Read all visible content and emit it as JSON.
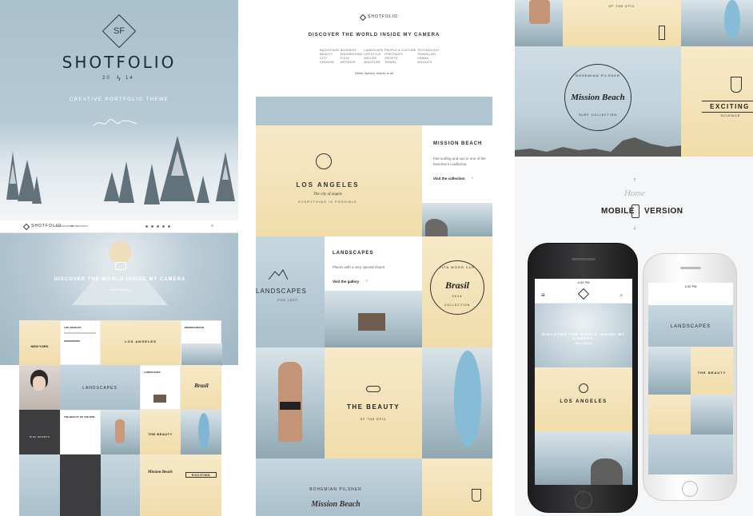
{
  "panel1": {
    "logo_mark": "SF",
    "brand": "SHOTFOLIO",
    "year_left": "20",
    "year_right": "14",
    "tagline": "CREATIVE PORTFOLIO THEME",
    "nav_brand": "SHOTFOLIO",
    "nav_items": [
      "SHOP",
      "CATEGORY",
      "BLOG",
      "CONTACT"
    ],
    "hero_title": "DISCOVER THE WORLD INSIDE MY CAMERA",
    "hero_sub": "Albert Spicery",
    "tiles": {
      "new_york": "NEW YORK",
      "los_angeles_title": "LOS ANGELES",
      "los_angeles_badge": "LOS ANGELES",
      "mission_beach": "MISSION BEACH",
      "landscapes": "LANDSCAPES",
      "landscapes_title": "LANDSCAPES",
      "brasil": "Brasil",
      "beauty_title": "THE BEAUTY OF THE EPIC",
      "beauty_badge": "THE BEAUTY",
      "risk_sports": "RISK SPORTS",
      "exciting": "EXCITING",
      "mission_small": "Mission Beach"
    }
  },
  "panel2": {
    "brand": "SHOTFOLIO",
    "title": "DISCOVER THE WORLD INSIDE MY CAMERA",
    "columns": [
      [
        "BACKSTAGE",
        "BEAUTY",
        "CITY",
        "FASHION"
      ],
      [
        "BUSINESS",
        "ENGINEERING",
        "FOOD",
        "INTERIOR"
      ],
      [
        "LANDSCAPE",
        "LIFESTYLE",
        "NATURE",
        "NIGHTLIFE"
      ],
      [
        "PEOPLE & CULTURE",
        "PORTRAITS",
        "SPORTS",
        "TRAVEL"
      ],
      [
        "TECHNOLOGY",
        "TRAVELLER",
        "URBAN",
        "WILDLIFE"
      ]
    ],
    "signature": "Albert Spicery, thanks to all",
    "mission_title": "MISSION BEACH",
    "mission_text": "Kite surfing and sun in one of the beaches in california.",
    "mission_link": "Visit the collection",
    "la_title": "LOS ANGELES",
    "la_script": "The city of angels",
    "la_sub": "EVERYTHING IS POSSIBLE",
    "landscapes_title": "LANDSCAPES",
    "landscapes_text": "Places with a very special charm.",
    "landscapes_link": "Visit the gallery",
    "landscapes_badge": "LANDSCAPES",
    "landscapes_badge_sub": "FOR LOST",
    "brasil_top": "FIFA WORD CUP",
    "brasil_script": "Brasil",
    "brasil_year": "2014",
    "brasil_bottom": "COLLECTION",
    "beauty_title": "THE BEAUTY",
    "beauty_sub": "OF THE EPIC",
    "bottom_arc": "BOHEMIAN PILSNER",
    "bottom_script": "Mission Beach"
  },
  "panel3": {
    "top_label": "OF THE EPIC",
    "mission_arc": "BOHEMIAN PILSNER",
    "mission_script": "Mission Beach",
    "mission_bottom": "SURF COLLECTION",
    "exciting": "EXCITING",
    "exciting_sub": "SCIENCE",
    "home_script": "Home",
    "mobile": "MOBILE",
    "version": "VERSION",
    "phone_time": "4:32 PM",
    "phone_hero": "DISCOVER THE WORLD INSIDE MY CAMERA",
    "phone_sub": "Albert Spicery",
    "phone_la": "LOS ANGELES",
    "phone_landscapes": "LANDSCAPES",
    "phone_beauty": "THE BEAUTY"
  }
}
